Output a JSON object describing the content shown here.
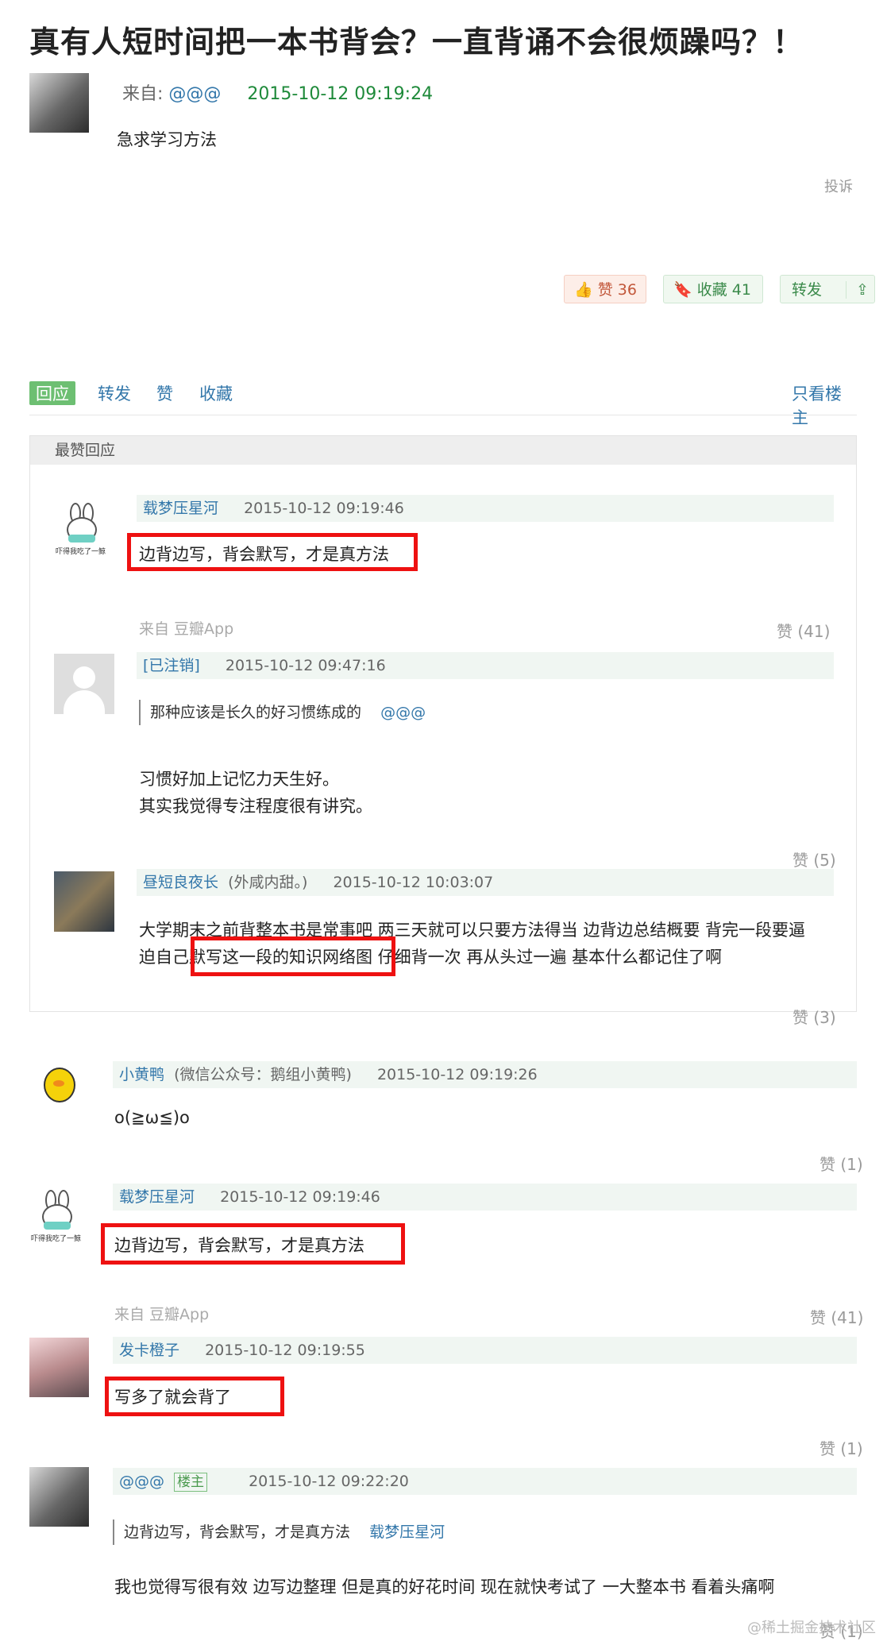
{
  "post": {
    "title": "真有人短时间把一本书背会？一直背诵不会很烦躁吗？！",
    "from_label": "来自:",
    "author": "@@@",
    "time": "2015-10-12 09:19:24",
    "body": "急求学习方法",
    "report": "投诉"
  },
  "actions": {
    "like": "赞 36",
    "collect": "收藏 41",
    "forward": "转发"
  },
  "tabs": {
    "reply": "回应",
    "forward": "转发",
    "like": "赞",
    "collect": "收藏",
    "only_host": "只看楼主"
  },
  "best": {
    "header": "最赞回应",
    "c1": {
      "user": "载梦压星河",
      "time": "2015-10-12 09:19:46",
      "text": "边背边写，背会默写，才是真方法",
      "source": "来自 豆瓣App",
      "likes": "赞 (41)"
    },
    "c2": {
      "user": "[已注销]",
      "time": "2015-10-12 09:47:16",
      "quote": "那种应该是长久的好习惯练成的",
      "quote_user": "@@@",
      "line1": "习惯好加上记忆力天生好。",
      "line2": "其实我觉得专注程度很有讲究。",
      "likes": "赞 (5)"
    },
    "c3": {
      "user": "昼短良夜长",
      "user_note": "(外咸内甜。)",
      "time": "2015-10-12 10:03:07",
      "line1": "大学期末之前背整本书是常事吧 两三天就可以只要方法得当 边背边总结概要 背完一段要逼",
      "line2": "迫自己默写这一段的知识网络图 仔细背一次 再从头过一遍 基本什么都记住了啊",
      "likes": "赞 (3)"
    }
  },
  "comments": {
    "c1": {
      "user": "小黄鸭",
      "user_note": "(微信公众号：鹅组小黄鸭)",
      "time": "2015-10-12 09:19:26",
      "text": "o(≧ω≦)o",
      "likes": "赞 (1)"
    },
    "c2": {
      "user": "载梦压星河",
      "time": "2015-10-12 09:19:46",
      "text": "边背边写，背会默写，才是真方法",
      "source": "来自 豆瓣App",
      "likes": "赞 (41)"
    },
    "c3": {
      "user": "发卡橙子",
      "time": "2015-10-12 09:19:55",
      "text": "写多了就会背了",
      "likes": "赞 (1)"
    },
    "c4": {
      "user": "@@@",
      "badge": "楼主",
      "time": "2015-10-12 09:22:20",
      "quote": "边背边写，背会默写，才是真方法",
      "quote_user": "载梦压星河",
      "text": "我也觉得写很有效 边写边整理 但是真的好花时间 现在就快考试了 一大整本书 看着头痛啊",
      "likes": "赞 (1)"
    }
  },
  "rabbit_caption": "吓得我吃了一鲸",
  "watermark": "@稀土掘金技术社区",
  "colors": {
    "link": "#3377aa",
    "green": "#1e8a3a",
    "highlight": "#ee1111",
    "meta_bg": "#f0f6f2"
  }
}
